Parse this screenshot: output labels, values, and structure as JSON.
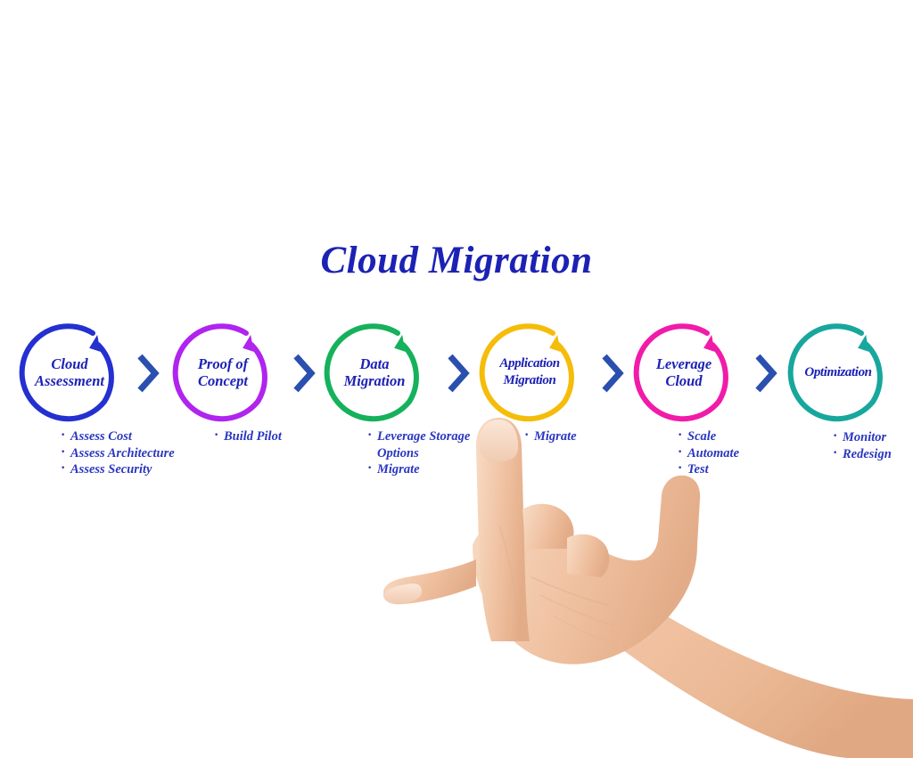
{
  "title": "Cloud Migration",
  "colors": {
    "title_text": "#1c22b4",
    "bullet_text": "#2b36c0",
    "chevron": "#2a4fae",
    "stage_1": "#2430cf",
    "stage_2": "#b024ef",
    "stage_3": "#15b15c",
    "stage_4": "#f5bc0a",
    "stage_5": "#f11ba9",
    "stage_6": "#17a79d"
  },
  "stages": [
    {
      "label": "Cloud Assessment",
      "label_line1": "Cloud",
      "label_line2": "Assessment",
      "color": "#2430cf",
      "bullets": [
        "Assess Cost",
        "Assess Architecture",
        "Assess Security"
      ]
    },
    {
      "label": "Proof of Concept",
      "label_line1": "Proof of",
      "label_line2": "Concept",
      "color": "#b024ef",
      "bullets": [
        "Build Pilot"
      ]
    },
    {
      "label": "Data Migration",
      "label_line1": "Data",
      "label_line2": "Migration",
      "color": "#15b15c",
      "bullets": [
        "Leverage Storage",
        "Migrate"
      ],
      "bullet_continuation": "Options"
    },
    {
      "label": "Application Migration",
      "label_line1": "Application",
      "label_line2": "Migration",
      "color": "#f5bc0a",
      "bullets": [
        "Migrate"
      ]
    },
    {
      "label": "Leverage Cloud",
      "label_line1": "Leverage",
      "label_line2": "Cloud",
      "color": "#f11ba9",
      "bullets": [
        "Scale",
        "Automate",
        "Test"
      ]
    },
    {
      "label": "Optimization",
      "label_line1": "Optimization",
      "label_line2": "",
      "color": "#17a79d",
      "bullets": [
        "Monitor",
        "Redesign"
      ]
    }
  ],
  "chevrons": [
    "chevron-right-1",
    "chevron-right-2",
    "chevron-right-3",
    "chevron-right-4",
    "chevron-right-5"
  ],
  "decoration": {
    "hand": "pointing-hand-photo"
  }
}
